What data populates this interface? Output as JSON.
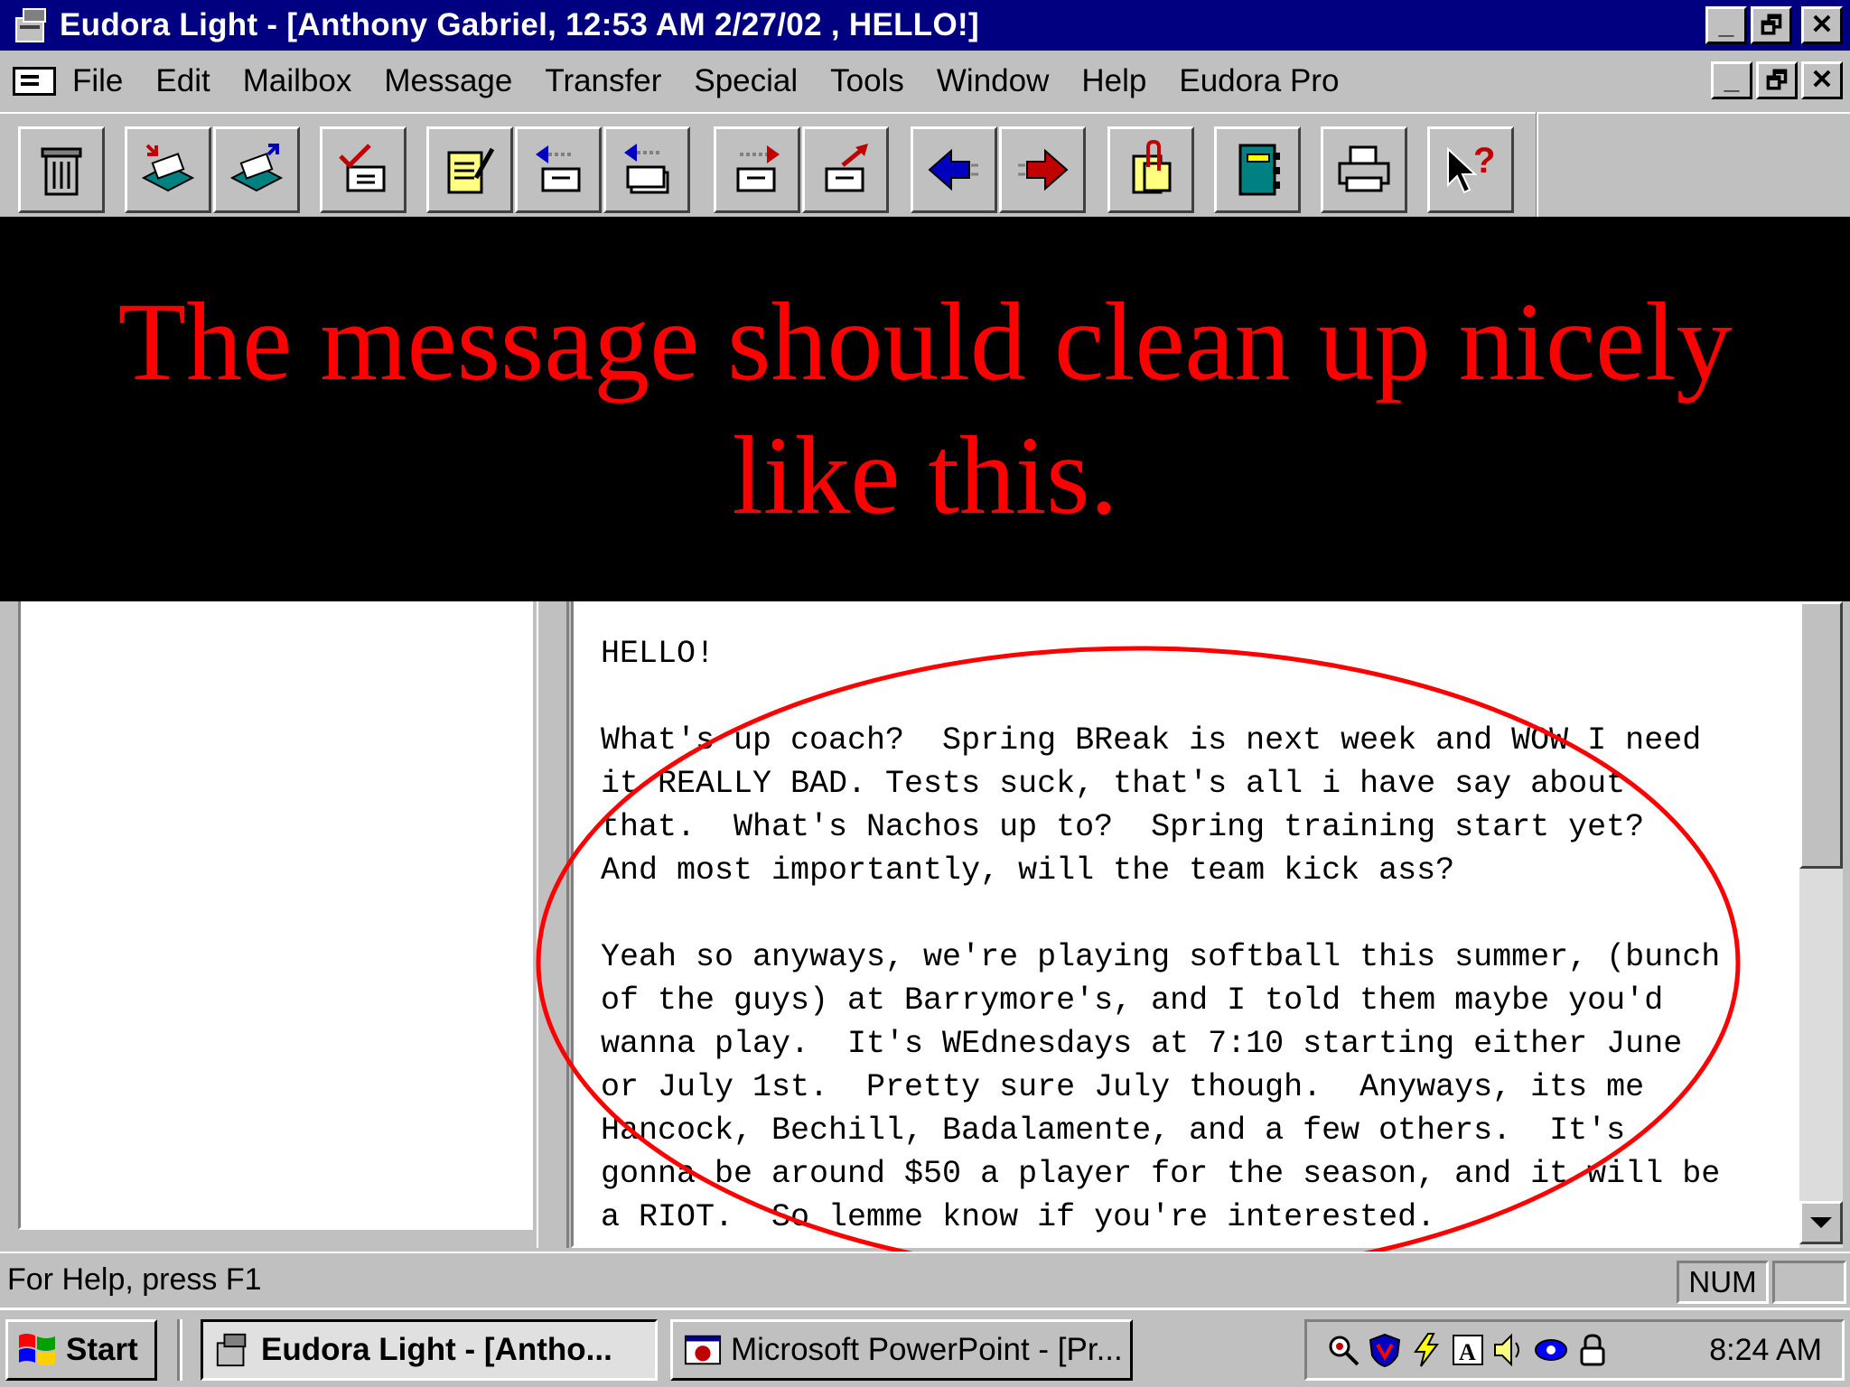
{
  "window": {
    "title": "Eudora Light - [Anthony Gabriel, 12:53 AM 2/27/02 , HELLO!]",
    "caption_buttons": [
      "_",
      "🗗",
      "✕"
    ]
  },
  "menubar": {
    "items": [
      "File",
      "Edit",
      "Mailbox",
      "Message",
      "Transfer",
      "Special",
      "Tools",
      "Window",
      "Help",
      "Eudora Pro"
    ],
    "doc_caption_buttons": [
      "_",
      "🗗",
      "✕"
    ]
  },
  "toolbar": {
    "buttons": [
      {
        "icon": "trash-icon"
      },
      {
        "icon": "inbox-in-icon"
      },
      {
        "icon": "inbox-out-icon"
      },
      {
        "icon": "check-mail-icon"
      },
      {
        "icon": "new-message-icon"
      },
      {
        "icon": "reply-icon"
      },
      {
        "icon": "reply-all-icon"
      },
      {
        "icon": "forward-icon"
      },
      {
        "icon": "redirect-icon"
      },
      {
        "icon": "previous-message-icon"
      },
      {
        "icon": "next-message-icon"
      },
      {
        "icon": "attach-icon"
      },
      {
        "icon": "address-book-icon"
      },
      {
        "icon": "print-icon"
      },
      {
        "icon": "context-help-icon"
      }
    ]
  },
  "overlay": {
    "caption": "The message should clean up nicely like this."
  },
  "message": {
    "body": "HELLO!\n\nWhat's up coach?  Spring BReak is next week and WOW I need\nit REALLY BAD. Tests suck, that's all i have say about\nthat.  What's Nachos up to?  Spring training start yet?\nAnd most importantly, will the team kick ass?\n\nYeah so anyways, we're playing softball this summer, (bunch\nof the guys) at Barrymore's, and I told them maybe you'd\nwanna play.  It's WEdnesdays at 7:10 starting either June\nor July 1st.  Pretty sure July though.  Anyways, its me\nHancock, Bechill, Badalamente, and a few others.  It's\ngonna be around $50 a player for the season, and it will be\na RIOT.  So lemme know if you're interested."
  },
  "statusbar": {
    "help_text": "For Help, press F1",
    "num_indicator": "NUM"
  },
  "taskbar": {
    "start_label": "Start",
    "tasks": [
      {
        "label": "Eudora Light - [Antho...",
        "active": true
      },
      {
        "label": "Microsoft PowerPoint - [Pr...",
        "active": false
      }
    ],
    "tray_icons": [
      "magnifier-icon",
      "shield-icon",
      "lightning-icon",
      "font-icon",
      "speaker-icon",
      "eye-icon",
      "lock-icon"
    ],
    "clock": "8:24 AM"
  },
  "colors": {
    "titlebar": "#000080",
    "annotation_red": "#ff0000",
    "overlay_bg": "#000000",
    "chrome": "#c0c0c0"
  }
}
